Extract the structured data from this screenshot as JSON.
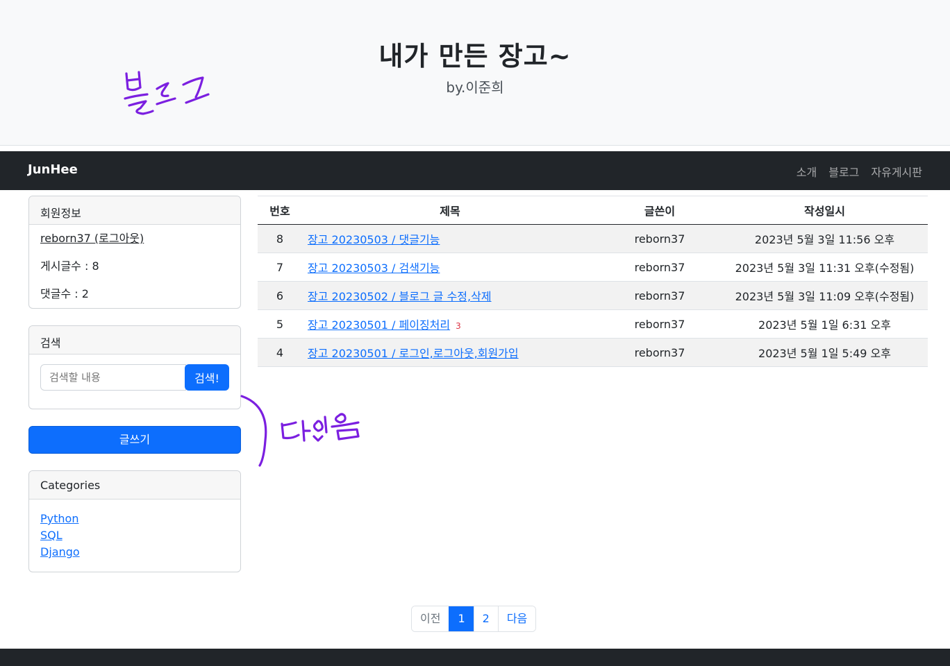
{
  "header": {
    "title": "내가 만든 장고~",
    "subtitle": "by.이준희",
    "annotation_blog": "블로그"
  },
  "navbar": {
    "brand": "JunHee",
    "links": [
      "소개",
      "블로그",
      "자유게시판"
    ]
  },
  "member_card": {
    "header": "회원정보",
    "user_link": "reborn37 (로그아웃)",
    "post_count": "게시글수 : 8",
    "comment_count": "댓글수 : 2"
  },
  "search_card": {
    "header": "검색",
    "placeholder": "검색할 내용",
    "button": "검색!"
  },
  "write_button": "글쓰기",
  "categories_card": {
    "header": "Categories",
    "items": [
      "Python",
      "SQL",
      "Django"
    ]
  },
  "annotation_all": "다있음",
  "table": {
    "headers": [
      "번호",
      "제목",
      "글쓴이",
      "작성일시"
    ],
    "rows": [
      {
        "num": "8",
        "title": "장고 20230503 / 댓글기능",
        "comments": "",
        "author": "reborn37",
        "date": "2023년 5월 3일 11:56 오후"
      },
      {
        "num": "7",
        "title": "장고 20230503 / 검색기능",
        "comments": "",
        "author": "reborn37",
        "date": "2023년 5월 3일 11:31 오후(수정됨)"
      },
      {
        "num": "6",
        "title": "장고 20230502 / 블로그 글 수정,삭제",
        "comments": "",
        "author": "reborn37",
        "date": "2023년 5월 3일 11:09 오후(수정됨)"
      },
      {
        "num": "5",
        "title": "장고 20230501 / 페이징처리",
        "comments": "3",
        "author": "reborn37",
        "date": "2023년 5월 1일 6:31 오후"
      },
      {
        "num": "4",
        "title": "장고 20230501 / 로그인,로그아웃,회원가입",
        "comments": "",
        "author": "reborn37",
        "date": "2023년 5월 1일 5:49 오후"
      }
    ]
  },
  "pagination": {
    "prev": "이전",
    "pages": [
      "1",
      "2"
    ],
    "active_page": "1",
    "next": "다음"
  },
  "colors": {
    "accent": "#0d6efd",
    "navbar": "#212529",
    "annotation": "#7b1fe0"
  }
}
